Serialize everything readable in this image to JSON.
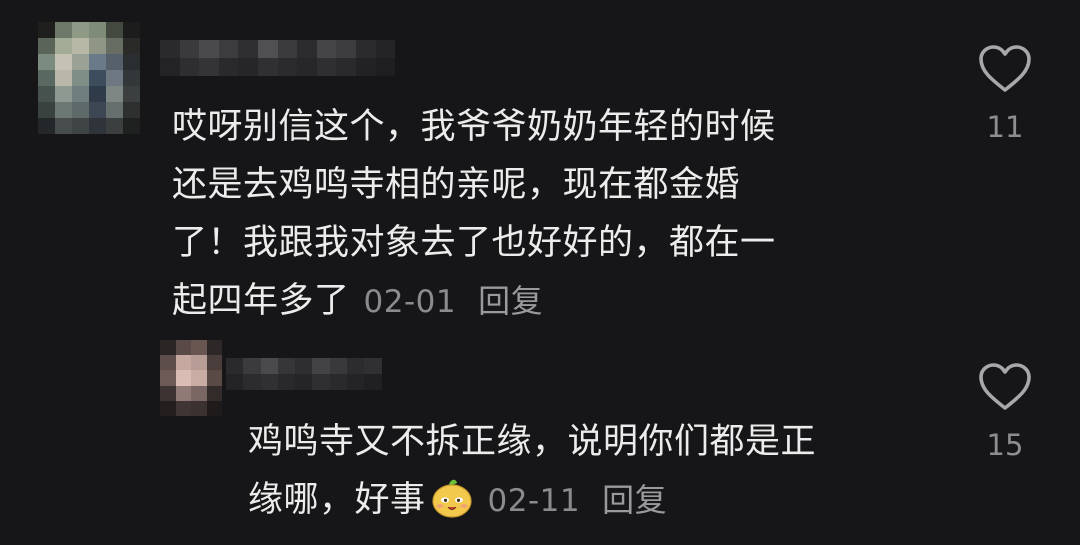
{
  "comments": [
    {
      "text_lines": [
        "哎呀别信这个，我爷爷奶奶年轻的时候",
        "还是去鸡鸣寺相的亲呢，现在都金婚",
        "了！我跟我对象去了也好好的，都在一",
        "起四年多了"
      ],
      "date": "02-01",
      "reply_label": "回复",
      "likes": "11",
      "like_icon": "heart-outline-icon"
    },
    {
      "text_lines": [
        "鸡鸣寺又不拆正缘，说明你们都是正",
        "缘哪，好事"
      ],
      "emoji": "smiling-face-sticker-icon",
      "date": "02-11",
      "reply_label": "回复",
      "likes": "15",
      "like_icon": "heart-outline-icon"
    }
  ],
  "colors": {
    "background": "#161618",
    "text": "#ececec",
    "meta": "#8b8b8e",
    "icon": "#a8a8ab"
  }
}
